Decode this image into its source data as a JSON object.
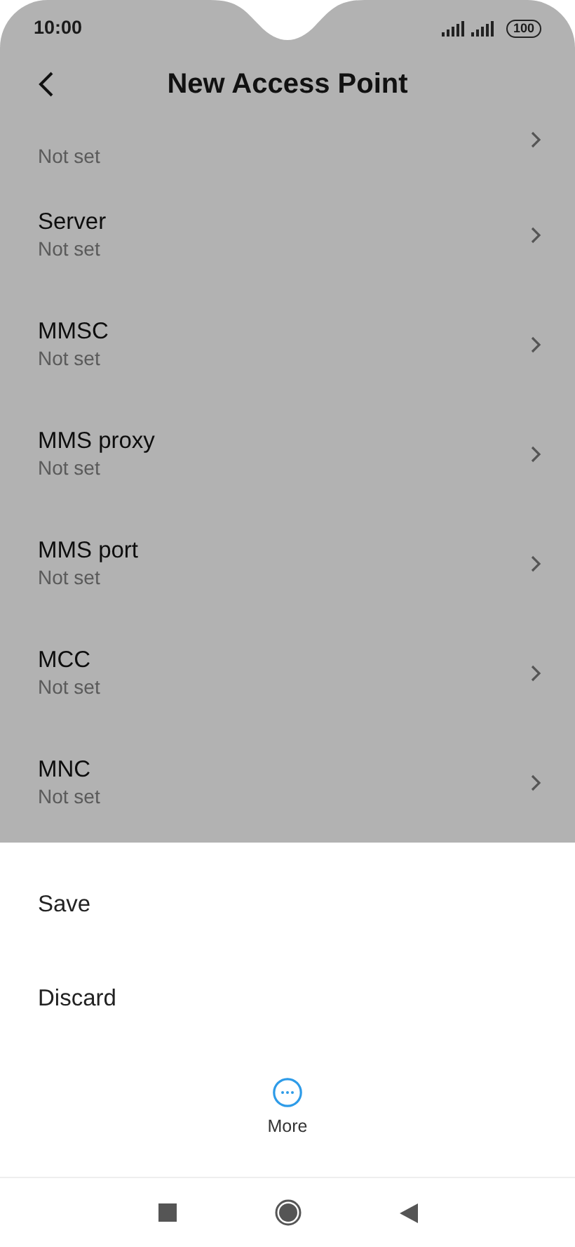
{
  "status_bar": {
    "time": "10:00",
    "battery": "100"
  },
  "header": {
    "title": "New Access Point"
  },
  "settings": [
    {
      "subtitle": "Not set"
    },
    {
      "title": "Server",
      "subtitle": "Not set"
    },
    {
      "title": "MMSC",
      "subtitle": "Not set"
    },
    {
      "title": "MMS proxy",
      "subtitle": "Not set"
    },
    {
      "title": "MMS port",
      "subtitle": "Not set"
    },
    {
      "title": "MCC",
      "subtitle": "Not set"
    },
    {
      "title": "MNC",
      "subtitle": "Not set"
    }
  ],
  "sheet": {
    "actions": [
      "Save",
      "Discard"
    ],
    "more": {
      "label": "More"
    }
  }
}
